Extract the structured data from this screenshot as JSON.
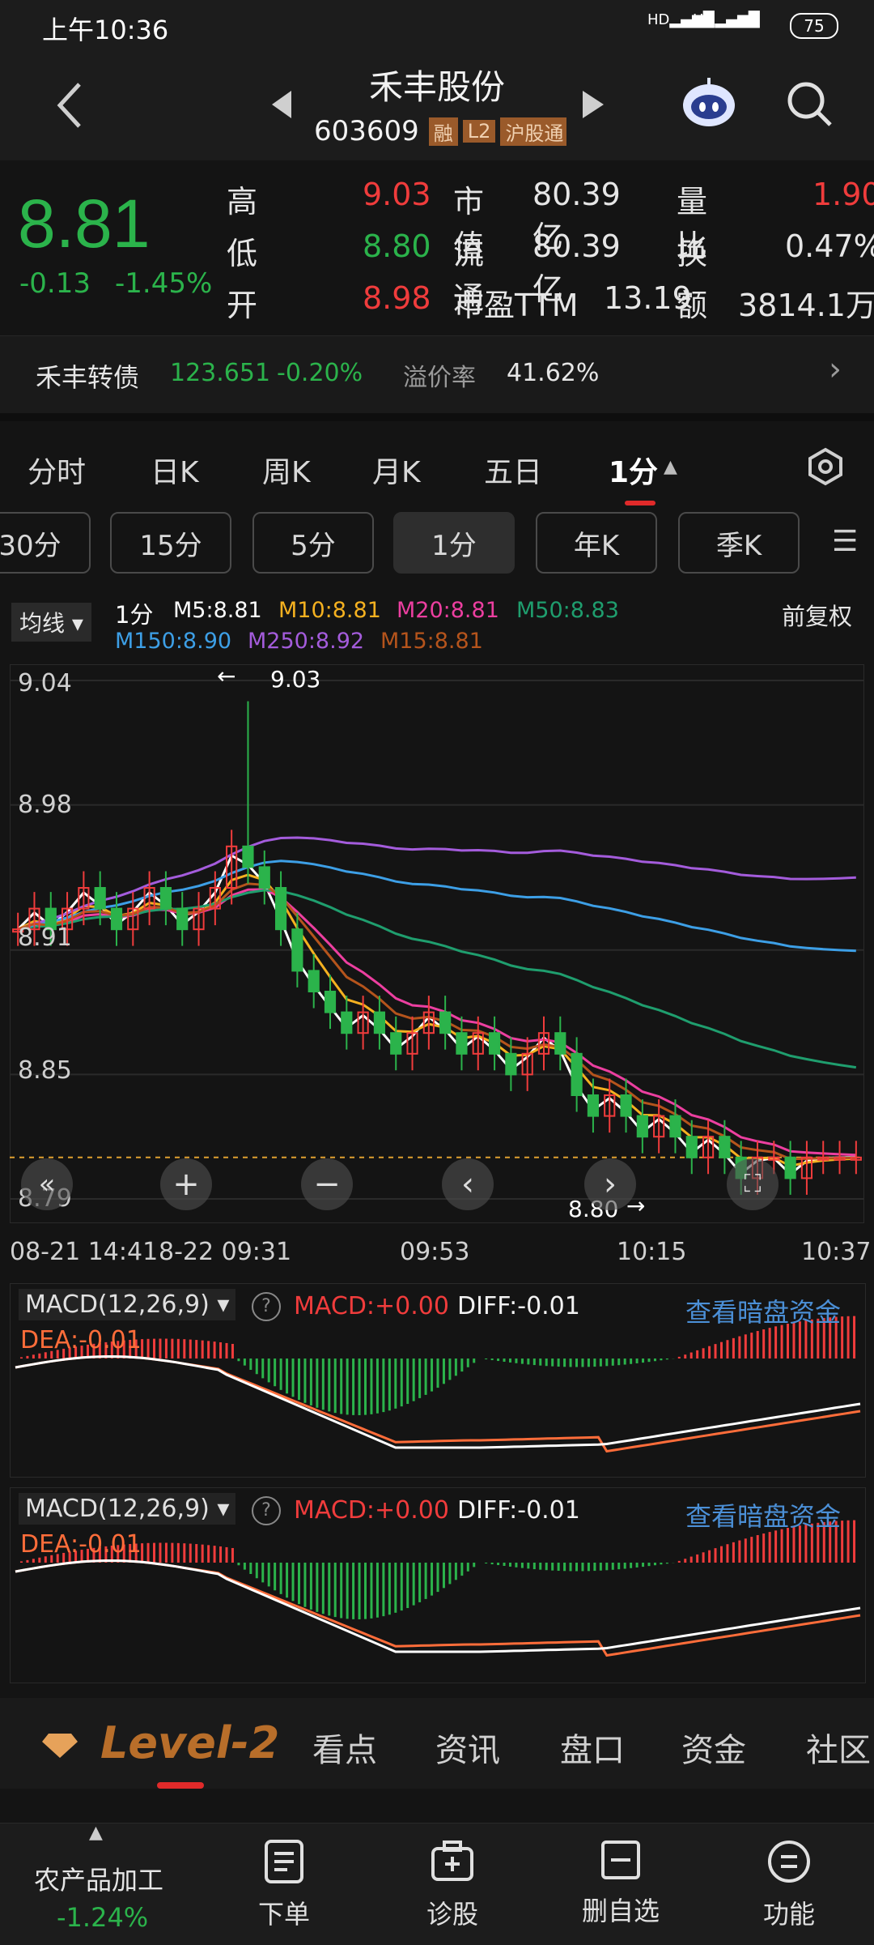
{
  "status_bar": {
    "time": "上午10:36",
    "signal1": "HD",
    "signal2": "HD",
    "battery": "75"
  },
  "header": {
    "stock_name": "禾丰股份",
    "stock_code": "603609",
    "badges": [
      "融",
      "L2",
      "沪股通"
    ]
  },
  "quote": {
    "price": "8.81",
    "change": "-0.13",
    "change_pct": "-1.45%",
    "rows": [
      {
        "l1": "高",
        "v1": "9.03",
        "l2": "市值",
        "v2": "80.39亿",
        "l3": "量比",
        "v3": "1.90"
      },
      {
        "l1": "低",
        "v1": "8.80",
        "l2": "流通",
        "v2": "80.39亿",
        "l3": "换",
        "v3": "0.47%"
      },
      {
        "l1": "开",
        "v1": "8.98",
        "l2": "市盈TTM",
        "v2": "13.19",
        "l3": "额",
        "v3": "3814.1万"
      }
    ]
  },
  "bond": {
    "name": "禾丰转债",
    "price": "123.651",
    "change": "-0.20%",
    "premium_label": "溢价率",
    "premium": "41.62%"
  },
  "tabs": [
    "分时",
    "日K",
    "周K",
    "月K",
    "五日",
    "1分"
  ],
  "periods": [
    "30分",
    "15分",
    "5分",
    "1分",
    "年K",
    "季K"
  ],
  "chart_header": {
    "ma_select": "均线",
    "period": "1分",
    "ma": [
      {
        "label": "M5:8.81",
        "color": "#ffffff"
      },
      {
        "label": "M10:8.81",
        "color": "#f5b120"
      },
      {
        "label": "M20:8.81",
        "color": "#ec3fa0"
      },
      {
        "label": "M50:8.83",
        "color": "#1f9e6e"
      },
      {
        "label": "M150:8.90",
        "color": "#3d9fe6"
      },
      {
        "label": "M250:8.92",
        "color": "#a45cdc"
      },
      {
        "label": "M15:8.81",
        "color": "#b5541c"
      }
    ],
    "adjust": "前复权"
  },
  "chart_data": {
    "type": "candlestick",
    "y_ticks": [
      "9.04",
      "8.98",
      "8.91",
      "8.85",
      "8.79"
    ],
    "ylim": [
      8.79,
      9.04
    ],
    "x_ticks": [
      "08-21 14:41",
      "8-22 09:31",
      "09:53",
      "10:15",
      "10:37"
    ],
    "high_mark": "9.03",
    "low_mark": "8.80",
    "close_series": [
      8.92,
      8.93,
      8.92,
      8.93,
      8.94,
      8.93,
      8.92,
      8.93,
      8.94,
      8.93,
      8.92,
      8.93,
      8.94,
      8.96,
      8.95,
      8.94,
      8.92,
      8.9,
      8.89,
      8.88,
      8.87,
      8.88,
      8.87,
      8.86,
      8.87,
      8.88,
      8.87,
      8.86,
      8.87,
      8.86,
      8.85,
      8.86,
      8.87,
      8.86,
      8.84,
      8.83,
      8.84,
      8.83,
      8.82,
      8.83,
      8.82,
      8.81,
      8.82,
      8.81,
      8.8,
      8.81,
      8.81,
      8.8,
      8.81,
      8.81,
      8.81,
      8.81
    ]
  },
  "macd_panels": [
    {
      "selector": "MACD(12,26,9)",
      "macd": "MACD:+0.00",
      "diff": "DIFF:-0.01",
      "dea": "DEA:-0.01",
      "link": "查看暗盘资金"
    },
    {
      "selector": "MACD(12,26,9)",
      "macd": "MACD:+0.00",
      "diff": "DIFF:-0.01",
      "dea": "DEA:-0.01",
      "link": "查看暗盘资金"
    }
  ],
  "bottom_tabs": [
    "Level-2",
    "看点",
    "资讯",
    "盘口",
    "资金",
    "社区"
  ],
  "toolbar": {
    "sector_name": "农产品加工",
    "sector_change": "-1.24%",
    "items": [
      "下单",
      "诊股",
      "删自选",
      "功能"
    ]
  }
}
